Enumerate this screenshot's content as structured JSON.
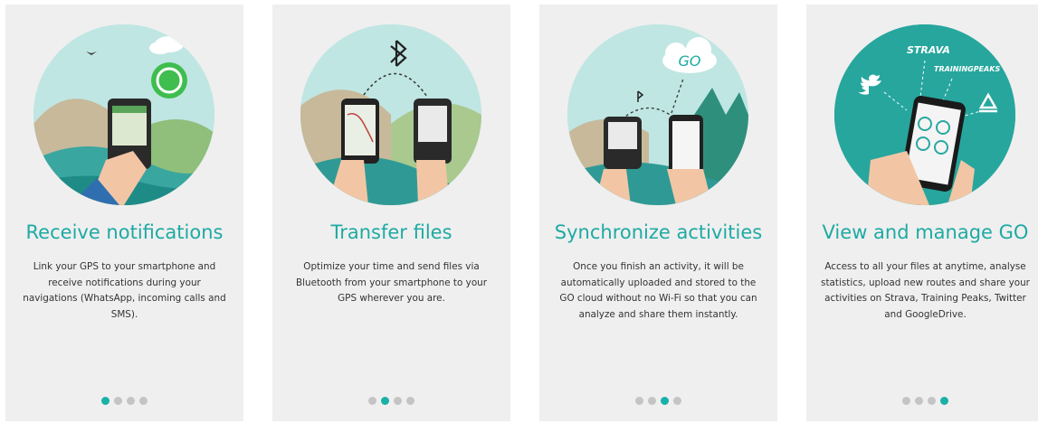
{
  "panels": [
    {
      "title": "Receive notifications",
      "description": "Link your GPS to your smartphone and receive notifications during your navigations (WhatsApp, incoming calls and SMS).",
      "icon": "whatsapp-notification-icon",
      "active_dot": 0
    },
    {
      "title": "Transfer files",
      "description": "Optimize your time and send files via Bluetooth from your smartphone to your GPS wherever you are.",
      "icon": "bluetooth-icon",
      "active_dot": 1
    },
    {
      "title": "Synchronize activities",
      "description": "Once you finish an activity, it will be automatically uploaded and stored to the GO cloud without no Wi-Fi so that you can analyze and share them instantly.",
      "icon": "cloud-sync-icon",
      "cloud_label": "GO",
      "active_dot": 2
    },
    {
      "title": "View and manage GO",
      "description": "Access to all your files at anytime, analyse statistics, upload new routes and share your activities on Strava, Training Peaks, Twitter and GoogleDrive.",
      "icon": "phone-app-icon",
      "strava_label": "STRAVA",
      "trainingpeaks_label": "TRAININGPEAKS",
      "active_dot": 3
    }
  ],
  "dot_count": 4,
  "colors": {
    "accent": "#1eaaa3",
    "dot_active": "#19b0a8",
    "dot_inactive": "#c4c4c4",
    "panel_bg": "#efefef"
  }
}
